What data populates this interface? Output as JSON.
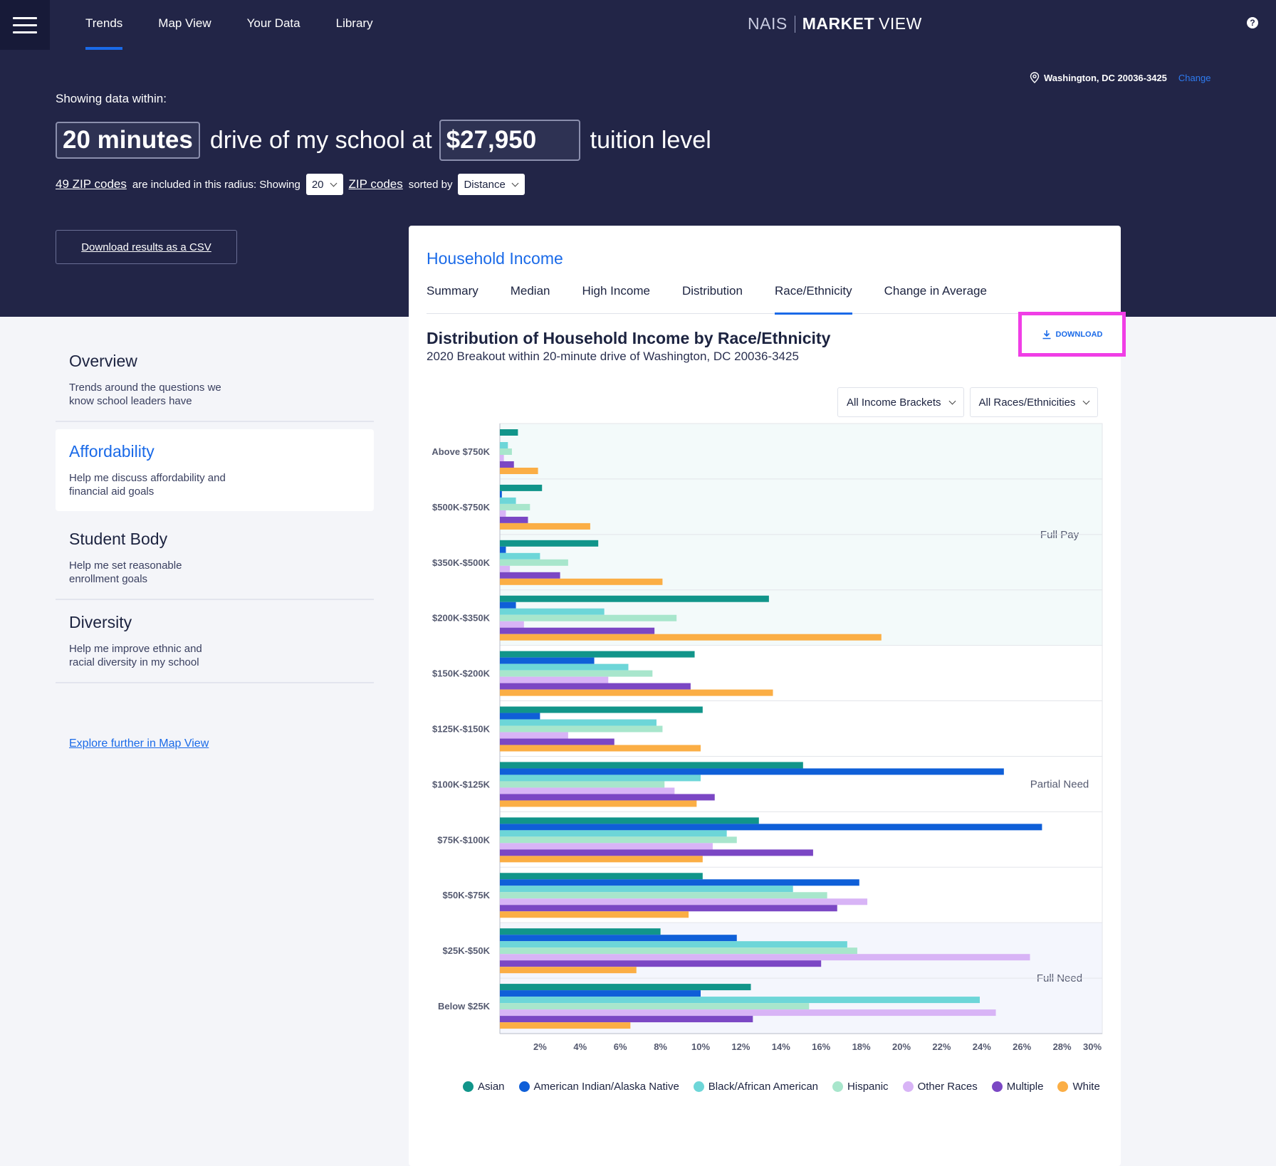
{
  "nav": {
    "items": [
      "Trends",
      "Map View",
      "Your Data",
      "Library"
    ],
    "active": "Trends"
  },
  "brand": {
    "nais": "NAIS",
    "market": "MARKET",
    "view": "VIEW"
  },
  "location": {
    "address": "Washington, DC 20036-3425",
    "change_label": "Change"
  },
  "filters_header": {
    "showing_label": "Showing data within:",
    "drive_time": "20 minutes",
    "drive_text": "drive of my school at",
    "tuition": "$27,950",
    "tuition_text": "tuition level",
    "zip_count_link": "49 ZIP codes",
    "zip_included_text": "are included in this radius: Showing",
    "zip_show_value": "20",
    "zip_codes_link": "ZIP codes",
    "sorted_by_text": "sorted by",
    "sort_value": "Distance",
    "csv_button": "Download results as a CSV"
  },
  "sidebar": {
    "items": [
      {
        "title": "Overview",
        "desc": "Trends around the questions we know school leaders have"
      },
      {
        "title": "Affordability",
        "desc": "Help me discuss affordability and financial aid goals"
      },
      {
        "title": "Student Body",
        "desc": "Help me set reasonable enrollment goals"
      },
      {
        "title": "Diversity",
        "desc": "Help me improve ethnic and racial diversity in my school"
      }
    ],
    "active": "Affordability",
    "explore_link": "Explore further in Map View"
  },
  "card": {
    "title": "Household Income",
    "tabs": [
      "Summary",
      "Median",
      "High Income",
      "Distribution",
      "Race/Ethnicity",
      "Change in Average"
    ],
    "active_tab": "Race/Ethnicity",
    "chart_title": "Distribution of Household Income by Race/Ethnicity",
    "chart_subtitle": "2020 Breakout within 20-minute drive of Washington, DC 20036-3425",
    "download_label": "DOWNLOAD",
    "filter_income": "All Income Brackets",
    "filter_race": "All Races/Ethnicities"
  },
  "chart_data": {
    "type": "bar",
    "orientation": "horizontal",
    "categories": [
      "Above $750K",
      "$500K-$750K",
      "$350K-$500K",
      "$200K-$350K",
      "$150K-$200K",
      "$125K-$150K",
      "$100K-$125K",
      "$75K-$100K",
      "$50K-$75K",
      "$25K-$50K",
      "Below $25K"
    ],
    "series": [
      {
        "name": "Asian",
        "color": "#11958a",
        "values": [
          0.9,
          2.1,
          4.9,
          13.4,
          9.7,
          10.1,
          15.1,
          12.9,
          10.1,
          8.0,
          12.5
        ]
      },
      {
        "name": "American Indian/Alaska Native",
        "color": "#0f5fd8",
        "values": [
          0.0,
          0.1,
          0.3,
          0.8,
          4.7,
          2.0,
          25.1,
          27.0,
          17.9,
          11.8,
          10.0
        ]
      },
      {
        "name": "Black/African American",
        "color": "#6dd6d8",
        "values": [
          0.4,
          0.8,
          2.0,
          5.2,
          6.4,
          7.8,
          10.0,
          11.3,
          14.6,
          17.3,
          23.9
        ]
      },
      {
        "name": "Hispanic",
        "color": "#a8e6cc",
        "values": [
          0.6,
          1.5,
          3.4,
          8.8,
          7.6,
          8.1,
          8.2,
          11.8,
          16.3,
          17.8,
          15.4
        ]
      },
      {
        "name": "Other Races",
        "color": "#d8b4f6",
        "values": [
          0.2,
          0.3,
          0.5,
          1.2,
          5.4,
          3.4,
          8.7,
          10.6,
          18.3,
          26.4,
          24.7
        ]
      },
      {
        "name": "Multiple",
        "color": "#7b47c4",
        "values": [
          0.7,
          1.4,
          3.0,
          7.7,
          9.5,
          5.7,
          10.7,
          15.6,
          16.8,
          16.0,
          12.6
        ]
      },
      {
        "name": "White",
        "color": "#fbae45",
        "values": [
          1.9,
          4.5,
          8.1,
          19.0,
          13.6,
          10.0,
          9.8,
          10.1,
          9.4,
          6.8,
          6.5
        ]
      }
    ],
    "xticks": [
      "2%",
      "4%",
      "6%",
      "8%",
      "10%",
      "12%",
      "14%",
      "16%",
      "18%",
      "20%",
      "22%",
      "24%",
      "26%",
      "28%",
      "30%"
    ],
    "xlim": [
      0,
      30
    ],
    "zones": [
      {
        "label": "Full Pay",
        "categories": [
          "Above $750K",
          "$500K-$750K",
          "$350K-$500K",
          "$200K-$350K"
        ],
        "color": "#f3fafa"
      },
      {
        "label": "Partial Need",
        "categories": [
          "$150K-$200K",
          "$125K-$150K",
          "$100K-$125K",
          "$75K-$100K",
          "$50K-$75K"
        ],
        "color": "#ffffff"
      },
      {
        "label": "Full Need",
        "categories": [
          "$25K-$50K",
          "Below $25K"
        ],
        "color": "#f4f6fd"
      }
    ],
    "legend_position": "bottom"
  }
}
